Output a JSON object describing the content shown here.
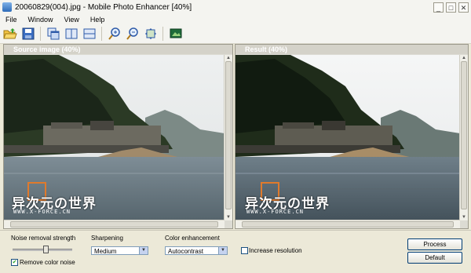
{
  "window": {
    "title": "20060829(004).jpg - Mobile Photo Enhancer [40%]"
  },
  "menu": [
    {
      "label": "File"
    },
    {
      "label": "Window"
    },
    {
      "label": "View"
    },
    {
      "label": "Help"
    }
  ],
  "toolbar": {
    "buttons": [
      {
        "icon": "open-folder-icon"
      },
      {
        "icon": "save-icon"
      },
      {
        "icon": "tile-windows-icon"
      },
      {
        "icon": "split-vertical-icon"
      },
      {
        "icon": "split-horizontal-icon"
      },
      {
        "icon": "zoom-in-icon"
      },
      {
        "icon": "zoom-out-icon"
      },
      {
        "icon": "fit-to-window-icon"
      },
      {
        "icon": "full-screen-icon"
      }
    ]
  },
  "panes": {
    "source": {
      "title": "Source image (40%)"
    },
    "result": {
      "title": "Result (40%)"
    }
  },
  "watermark": {
    "title": "异次元の世界",
    "subtitle": "WWW.X-FORCE.CN"
  },
  "controls": {
    "noise": {
      "label": "Noise removal strength",
      "level": 0.55
    },
    "remove_color_noise": {
      "label": "Remove color noise",
      "checked": true
    },
    "sharpening": {
      "label": "Sharpening",
      "value": "Medium"
    },
    "color": {
      "label": "Color enhancement",
      "value": "Autocontrast"
    },
    "increase_resolution": {
      "label": "Increase resolution",
      "checked": false
    },
    "process_button": "Process",
    "default_button": "Default"
  },
  "colors": {
    "accent": "#e07a2c",
    "button_border": "#003c74",
    "select_border": "#7f9db9"
  }
}
